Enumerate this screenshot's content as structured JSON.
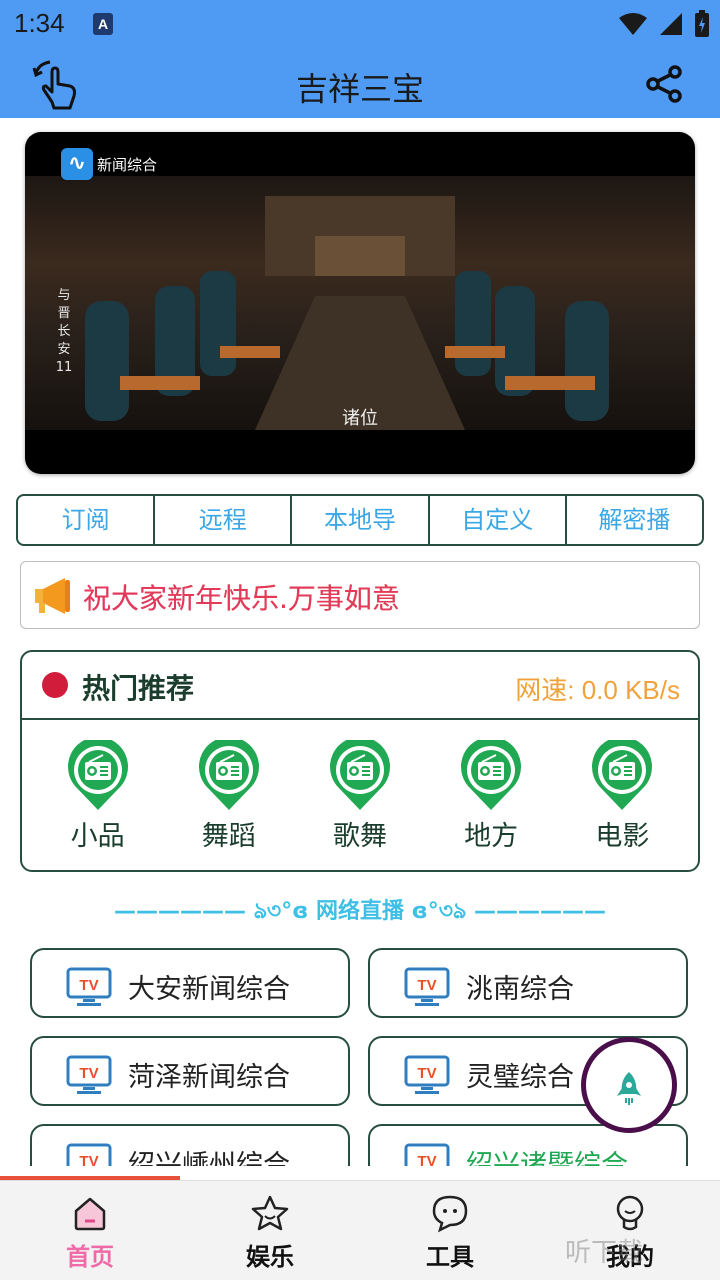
{
  "status": {
    "time": "1:34",
    "notif_badge": "A"
  },
  "app_bar": {
    "title": "吉祥三宝",
    "back_icon": "hand-tap-icon",
    "share_icon": "share-icon"
  },
  "video": {
    "channel_name": "新闻综合",
    "vertical_title": "与晋长安11",
    "subtitle": "诸位"
  },
  "tabs": [
    "订阅",
    "远程",
    "本地导",
    "自定义",
    "解密播"
  ],
  "notice": {
    "text": "祝大家新年快乐.万事如意",
    "icon": "megaphone-icon"
  },
  "hot": {
    "title": "热门推荐",
    "speed": "网速: 0.0 KB/s",
    "items": [
      "小品",
      "舞蹈",
      "歌舞",
      "地方",
      "电影"
    ]
  },
  "section_divider": "—————— ঌ৩°ɞ 网络直播 ɞ°৩ঌ ——————",
  "channels": [
    "大安新闻综合",
    "洮南综合",
    "菏泽新闻综合",
    "灵璧综合",
    "绍兴嵊州综合",
    "绍兴诸暨综合"
  ],
  "nav": {
    "items": [
      "首页",
      "娱乐",
      "工具",
      "我的"
    ],
    "active": "首页"
  },
  "watermark": "听下载",
  "colors": {
    "primary": "#4f9af3",
    "accent_green": "#21a852",
    "tab_text": "#3aa7e6",
    "border": "#274e3e",
    "speed": "#f0a23a",
    "active_nav": "#f06aa8"
  }
}
